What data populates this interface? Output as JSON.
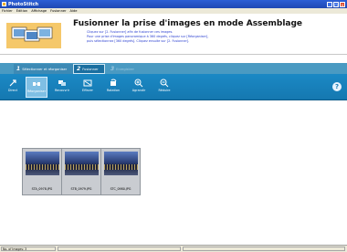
{
  "window": {
    "title": "PhotoStitch"
  },
  "menu": [
    "Fichier",
    "Édition",
    "Affichage",
    "Fusionner",
    "Aide"
  ],
  "banner": {
    "heading": "Fusionner la prise d'images en mode Assemblage",
    "lines": [
      "Cliquez sur [2. Fusionner] afin de fusionner ces images.",
      "Pour une prise d'images panoramique à 360 degrés, cliquez sur [Réorganiser],",
      "puis sélectionnez [360 degrés]. Cliquez ensuite sur [2. Fusionner]."
    ]
  },
  "tabs": [
    {
      "num": "1",
      "label": "Sélectionner et réorganiser",
      "state": "done"
    },
    {
      "num": "2",
      "label": "Fusionner",
      "state": "active"
    },
    {
      "num": "3",
      "label": "Enregistrer",
      "state": "disabled"
    }
  ],
  "toolbar": {
    "items": [
      {
        "label": "Direct",
        "icon": "direct-icon"
      },
      {
        "label": "Réorganiser",
        "icon": "reorganize-icon",
        "pressed": true
      },
      {
        "label": "Recouvrir",
        "icon": "cover-icon"
      },
      {
        "label": "Effacer",
        "icon": "erase-icon"
      },
      {
        "label": "Rotation",
        "icon": "rotate-icon"
      },
      {
        "label": "Agrandir",
        "icon": "zoom-in-icon"
      },
      {
        "label": "Réduire",
        "icon": "zoom-out-icon"
      }
    ],
    "help_label": "?"
  },
  "images": [
    {
      "filename": "STA_0978.JPG"
    },
    {
      "filename": "STB_0979.JPG"
    },
    {
      "filename": "STC_0980.JPG"
    }
  ],
  "status": {
    "text": "No. of Images: 3"
  },
  "colors": {
    "toolbar": "#1578b0",
    "tabstrip": "#4a9ac2",
    "banner_text": "#2a3fd0"
  }
}
